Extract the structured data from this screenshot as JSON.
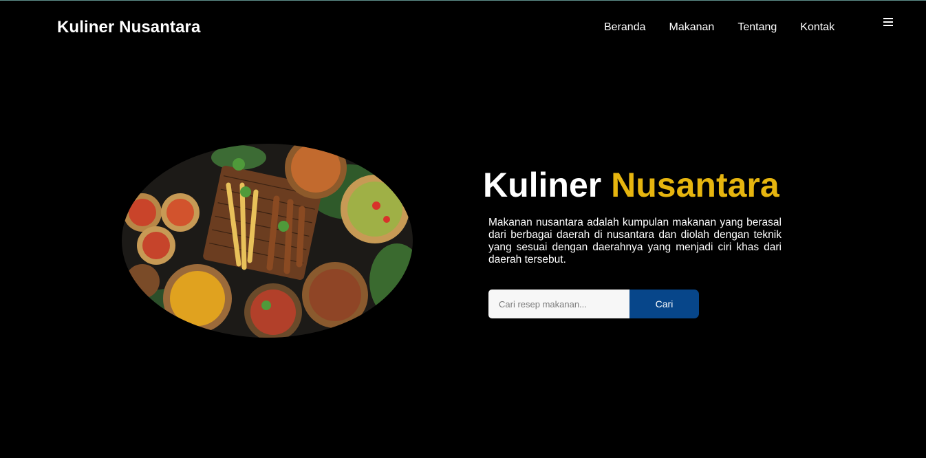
{
  "header": {
    "brand": "Kuliner Nusantara",
    "nav": [
      "Beranda",
      "Makanan",
      "Tentang",
      "Kontak"
    ],
    "menu_icon": "hamburger-icon"
  },
  "hero": {
    "title_part1": "Kuliner",
    "title_part2": "Nusantara",
    "description": "Makanan nusantara adalah kumpulan makanan yang berasal dari berbagai daerah di nusantara dan diolah dengan teknik yang sesuai dengan daerahnya yang menjadi ciri khas dari daerah tersebut.",
    "image_alt": "food-spread-image"
  },
  "search": {
    "placeholder": "Cari resep makanan...",
    "value": "",
    "button_label": "Cari"
  },
  "colors": {
    "background": "#000000",
    "accent": "#e6b50f",
    "button": "#07468a"
  }
}
